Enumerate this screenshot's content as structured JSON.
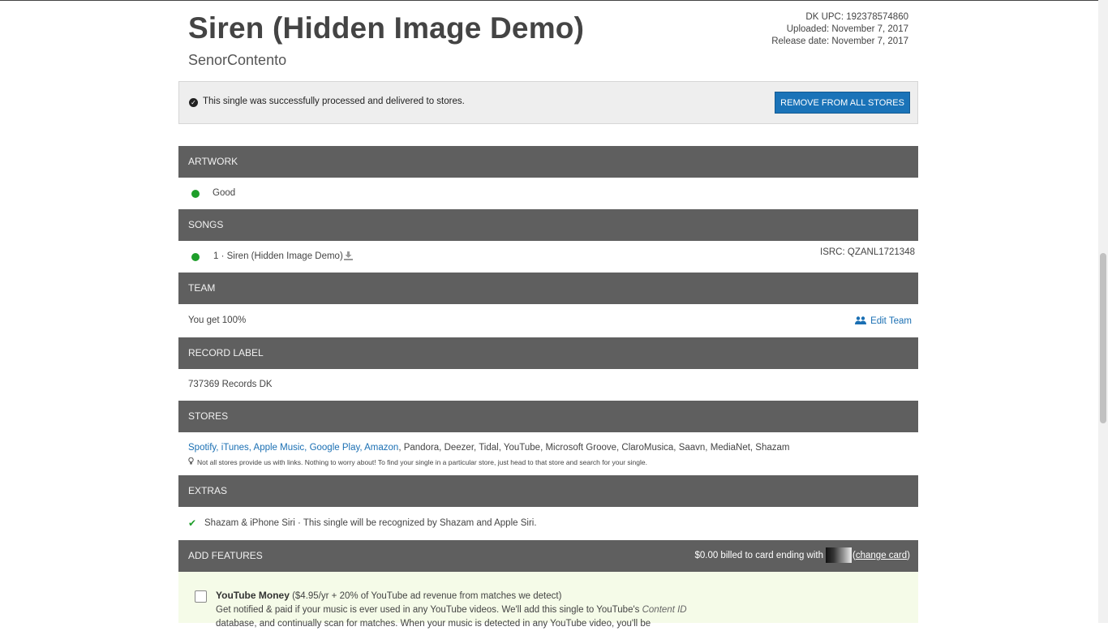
{
  "header": {
    "title": "Siren (Hidden Image Demo)",
    "artist": "SenorContento",
    "upc": "DK UPC: 192378574860",
    "uploaded": "Uploaded: November 7, 2017",
    "release_date": "Release date: November 7, 2017"
  },
  "status": {
    "message": "This single was successfully processed and delivered to stores.",
    "remove_button": "REMOVE FROM ALL STORES"
  },
  "artwork": {
    "heading": "ARTWORK",
    "status": "Good",
    "status_color": "#1e9e2a"
  },
  "songs": {
    "heading": "SONGS",
    "items": [
      {
        "label": "1 · Siren (Hidden Image Demo)",
        "isrc": "ISRC: QZANL1721348"
      }
    ]
  },
  "team": {
    "heading": "TEAM",
    "share": "You get 100%",
    "edit_label": "Edit Team"
  },
  "record_label": {
    "heading": "RECORD LABEL",
    "value": "737369 Records DK"
  },
  "stores": {
    "heading": "STORES",
    "linked": "Spotify, iTunes, Apple Music, Google Play, Amazon",
    "unlinked": ", Pandora, Deezer, Tidal, YouTube, Microsoft Groove, ClaroMusica, Saavn, MediaNet, Shazam",
    "note": "Not all stores provide us with links. Nothing to worry about! To find your single in a particular store, just head to that store and search for your single."
  },
  "extras": {
    "heading": "EXTRAS",
    "item": "Shazam & iPhone Siri · This single will be recognized by Shazam and Apple Siri."
  },
  "add_features": {
    "heading": "ADD FEATURES",
    "billing_prefix": "$0.00 billed to card ending with",
    "change_card": "change card",
    "paren_open": "(",
    "paren_close": ")",
    "youtube": {
      "title": "YouTube Money",
      "price": " ($4.95/yr + 20% of YouTube ad revenue from matches we detect)",
      "desc_line1": "Get notified & paid if your music is ever used in any YouTube videos. We'll add this single to YouTube's ",
      "desc_italic": "Content ID",
      "desc_line2": "database, and continually scan for matches. When your music is detected in any YouTube video, you'll be"
    }
  },
  "colors": {
    "accent": "#1a73b8",
    "section_header": "#5f5f5f",
    "status_bg": "#eeeeee",
    "feature_bg": "#f5fbe8"
  }
}
